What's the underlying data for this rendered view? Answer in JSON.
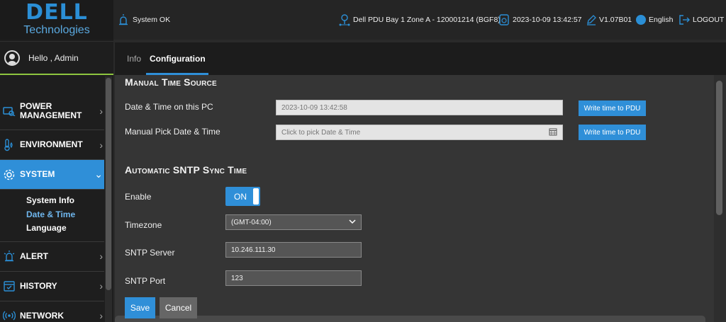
{
  "logo": {
    "mark": "DELL",
    "sub": "Technologies"
  },
  "user": {
    "greeting": "Hello , Admin"
  },
  "nav": {
    "items": [
      {
        "label_line1": "POWER",
        "label_line2": "MANAGEMENT",
        "icon": "power-management-icon"
      },
      {
        "label": "ENVIRONMENT",
        "icon": "environment-icon"
      },
      {
        "label": "SYSTEM",
        "icon": "gear-icon"
      },
      {
        "label": "ALERT",
        "icon": "alert-icon"
      },
      {
        "label": "HISTORY",
        "icon": "calendar-icon"
      },
      {
        "label": "NETWORK",
        "icon": "network-icon"
      }
    ],
    "system_sub": [
      "System Info",
      "Date & Time",
      "Language"
    ]
  },
  "header": {
    "status": "System OK",
    "pdu": "Dell PDU Bay 1 Zone A - 120001214 (BGF8)",
    "datetime": "2023-10-09 13:42:57",
    "version": "V1.07B01",
    "language": "English",
    "logout": "LOGOUT"
  },
  "tabs": {
    "info": "Info",
    "configuration": "Configuration"
  },
  "manual": {
    "title": "Manual Time Source",
    "pc_label": "Date & Time on this PC",
    "pc_value": "2023-10-09 13:42:58",
    "pick_label": "Manual Pick Date & Time",
    "pick_placeholder": "Click to pick Date & Time",
    "write_label": "Write time to PDU"
  },
  "sntp": {
    "title": "Automatic SNTP Sync Time",
    "enable_label": "Enable",
    "enable_state": "ON",
    "timezone_label": "Timezone",
    "timezone_value": "(GMT-04:00)",
    "server_label": "SNTP Server",
    "server_value": "10.246.111.30",
    "port_label": "SNTP Port",
    "port_value": "123"
  },
  "actions": {
    "save": "Save",
    "cancel": "Cancel"
  },
  "colors": {
    "accent": "#2f8fd8",
    "user_divider": "#8ec63f"
  }
}
